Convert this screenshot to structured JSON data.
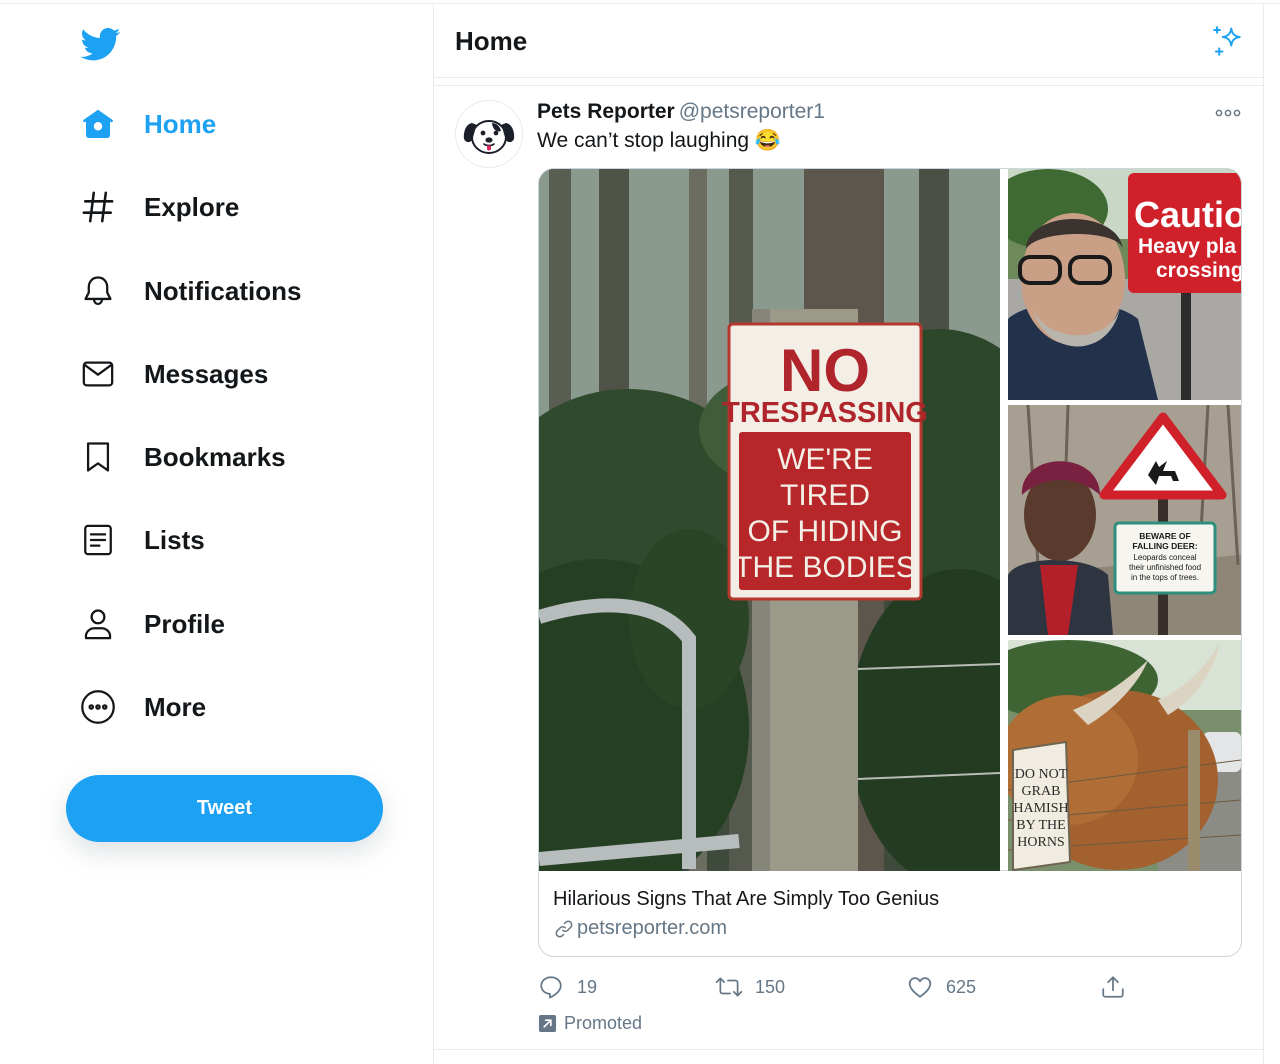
{
  "colors": {
    "accent": "#1da1f2",
    "text_primary": "#14171a",
    "text_secondary": "#657786",
    "border": "#e6ecf0"
  },
  "sidebar": {
    "logo_icon": "twitter-bird-icon",
    "items": [
      {
        "label": "Home",
        "icon": "home-icon",
        "active": true
      },
      {
        "label": "Explore",
        "icon": "hashtag-icon",
        "active": false
      },
      {
        "label": "Notifications",
        "icon": "bell-icon",
        "active": false
      },
      {
        "label": "Messages",
        "icon": "envelope-icon",
        "active": false
      },
      {
        "label": "Bookmarks",
        "icon": "bookmark-icon",
        "active": false
      },
      {
        "label": "Lists",
        "icon": "list-icon",
        "active": false
      },
      {
        "label": "Profile",
        "icon": "person-icon",
        "active": false
      },
      {
        "label": "More",
        "icon": "more-circle-icon",
        "active": false
      }
    ],
    "tweet_button_label": "Tweet"
  },
  "header": {
    "title": "Home",
    "top_tweets_icon": "sparkle-icon"
  },
  "tweet": {
    "author_name": "Pets Reporter",
    "author_handle": "@petsreporter1",
    "avatar_icon": "dog-avatar-icon",
    "text": "We can’t stop laughing 😂",
    "card": {
      "title": "Hilarious Signs That Are Simply Too Genius",
      "domain": "petsreporter.com",
      "images": [
        {
          "sign_lines": [
            "NO",
            "TRESPASSING",
            "WE'RE",
            "TIRED",
            "OF HIDING",
            "THE BODIES"
          ]
        },
        {
          "sign_lines": [
            "Cautio",
            "Heavy pla",
            "crossing"
          ]
        },
        {
          "sign_lines": [
            "BEWARE OF",
            "FALLING DEER:",
            "Leopards conceal",
            "their unfinished food",
            "in the tops of trees."
          ]
        },
        {
          "sign_lines": [
            "DO NOT",
            "GRAB",
            "HAMISH",
            "BY THE",
            "HORNS"
          ]
        }
      ]
    },
    "actions": {
      "replies": "19",
      "retweets": "150",
      "likes": "625"
    },
    "promoted_label": "Promoted"
  }
}
